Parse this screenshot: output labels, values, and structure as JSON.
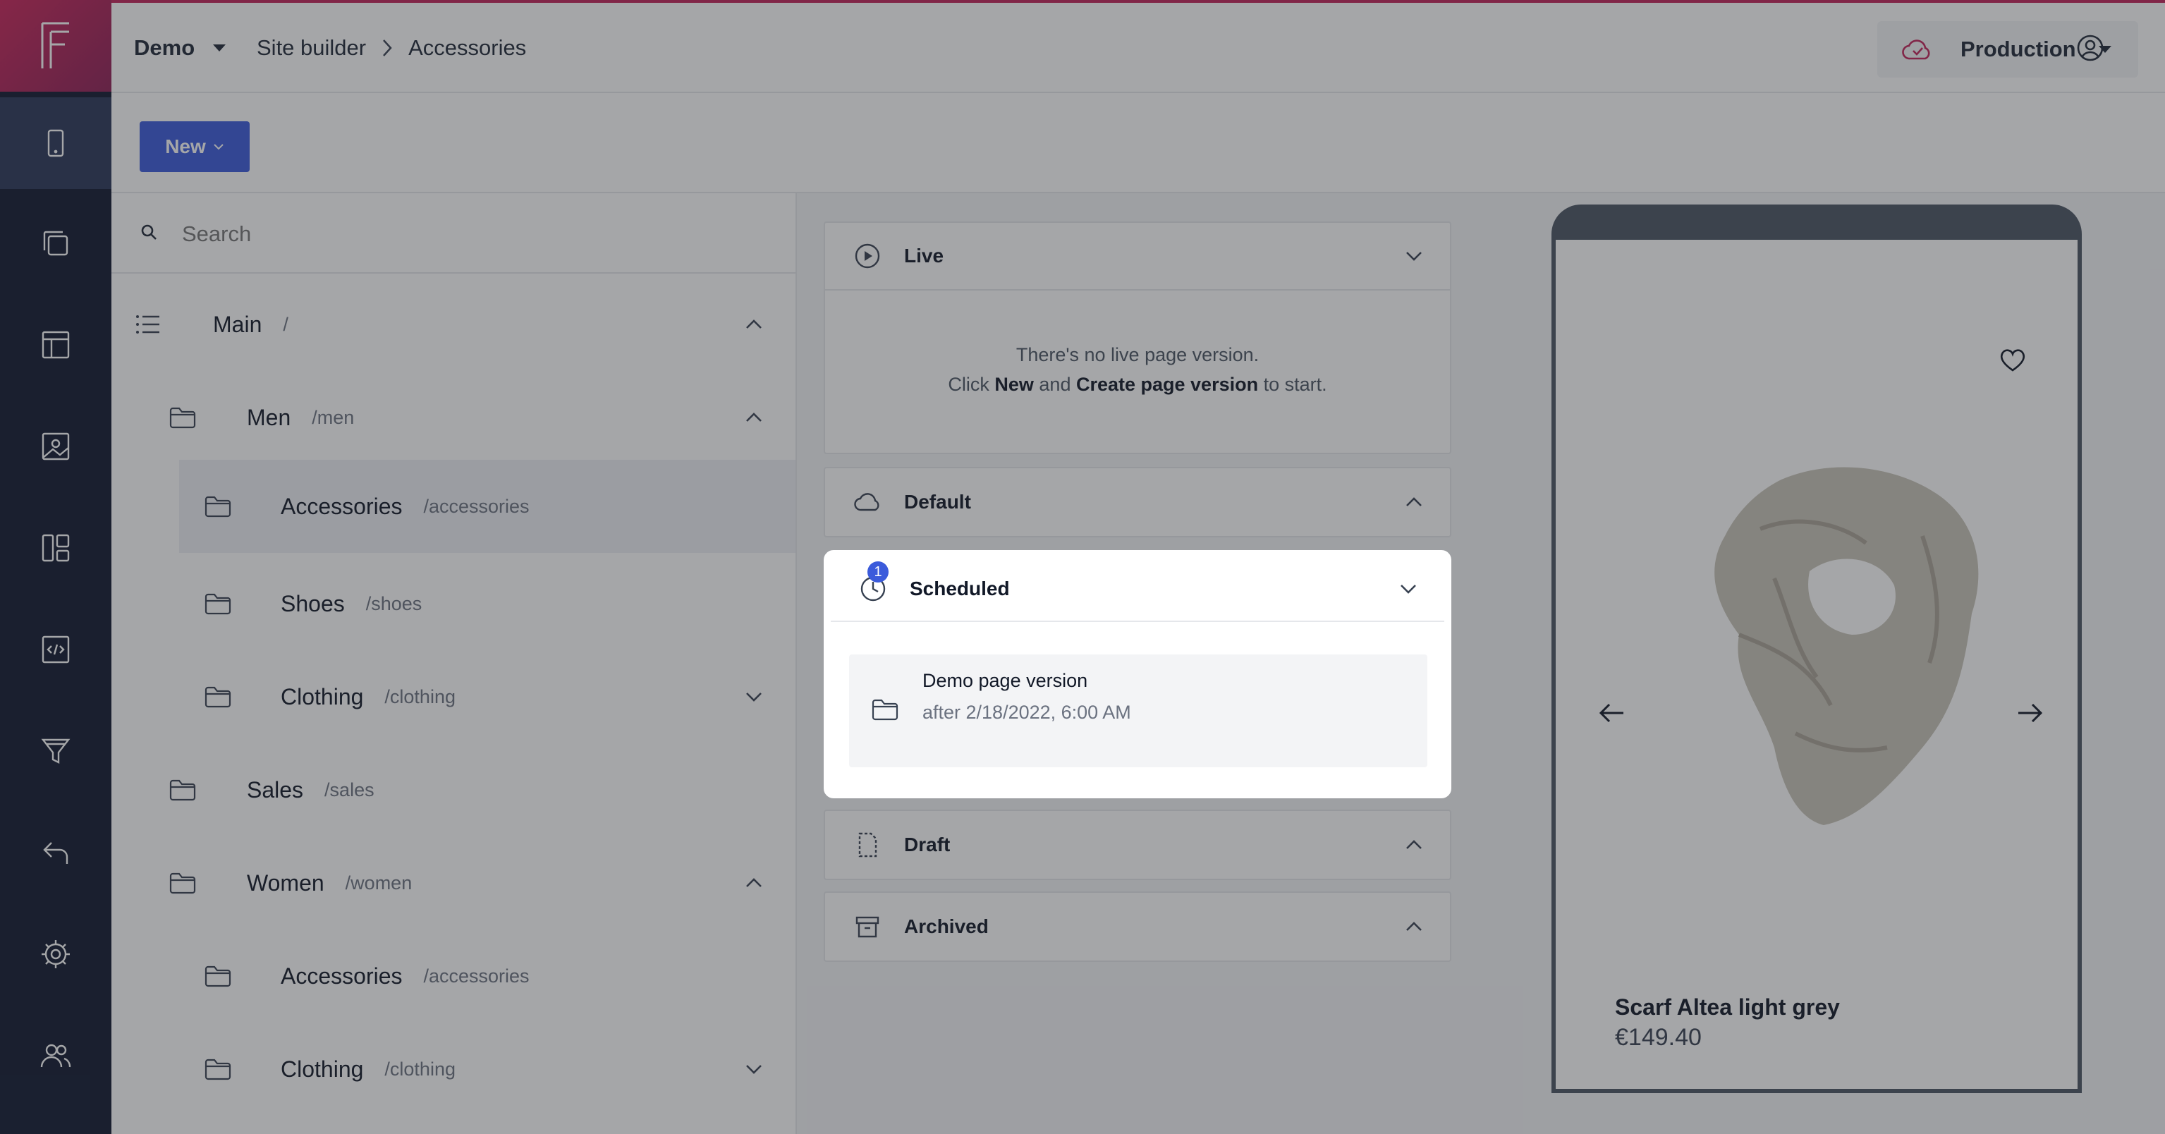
{
  "breadcrumb": {
    "project": "Demo",
    "section": "Site builder",
    "current": "Accessories"
  },
  "environment": {
    "label": "Production"
  },
  "toolbar": {
    "new_label": "New"
  },
  "search": {
    "placeholder": "Search"
  },
  "tree": {
    "main": {
      "name": "Main",
      "path": "/"
    },
    "men": {
      "name": "Men",
      "path": "/men"
    },
    "men_accessories": {
      "name": "Accessories",
      "path": "/accessories"
    },
    "men_shoes": {
      "name": "Shoes",
      "path": "/shoes"
    },
    "men_clothing": {
      "name": "Clothing",
      "path": "/clothing"
    },
    "sales": {
      "name": "Sales",
      "path": "/sales"
    },
    "women": {
      "name": "Women",
      "path": "/women"
    },
    "women_accessories": {
      "name": "Accessories",
      "path": "/accessories"
    },
    "women_clothing": {
      "name": "Clothing",
      "path": "/clothing"
    }
  },
  "versions": {
    "live": {
      "title": "Live",
      "empty_line1": "There's no live page version.",
      "empty_click": "Click ",
      "empty_new": "New",
      "empty_and": " and ",
      "empty_create": "Create page version",
      "empty_end": " to start."
    },
    "default": {
      "title": "Default"
    },
    "scheduled": {
      "title": "Scheduled",
      "badge_count": "1",
      "item_title": "Demo page version",
      "item_date": "after 2/18/2022, 6:00 AM"
    },
    "draft": {
      "title": "Draft"
    },
    "archived": {
      "title": "Archived"
    }
  },
  "preview": {
    "product_title": "Scarf Altea light grey",
    "product_price": "€149.40"
  },
  "colors": {
    "rail": "#101830",
    "brand": "#c2245a",
    "primary": "#3b5bdb"
  }
}
